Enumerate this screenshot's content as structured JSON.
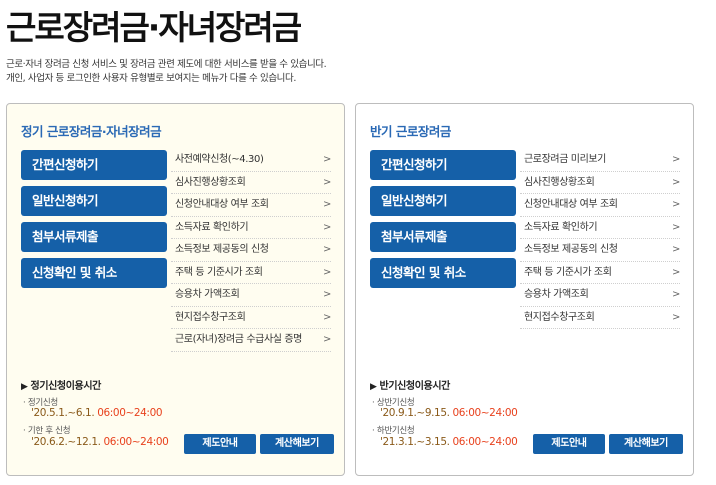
{
  "header": {
    "title": "근로장려금·자녀장려금",
    "desc1": "근로·자녀 장려금 신청 서비스 및 장려금 관련 제도에 대한 서비스를 받을 수 있습니다.",
    "desc2": "개인, 사업자 등 로그인한 사용자 유형별로 보여지는 메뉴가 다를 수 있습니다."
  },
  "left": {
    "title": "정기 근로장려금·자녀장려금",
    "buttons": [
      "간편신청하기",
      "일반신청하기",
      "첨부서류제출",
      "신청확인 및 취소"
    ],
    "links": [
      "사전예약신청(~4.30)",
      "심사진행상황조회",
      "신청안내대상 여부 조회",
      "소득자료 확인하기",
      "소득정보 제공동의 신청",
      "주택 등 기준시가 조회",
      "승용차 가액조회",
      "현지접수창구조회",
      "근로(자녀)장려금 수급사실 증명"
    ],
    "usage_title": "정기신청이용시간",
    "usage": [
      {
        "label": "정기신청",
        "date": "'20.5.1.~6.1.",
        "time": "06:00~24:00"
      },
      {
        "label": "기한 후 신청",
        "date": "'20.6.2.~12.1.",
        "time": "06:00~24:00"
      }
    ],
    "btn1": "제도안내",
    "btn2": "계산해보기"
  },
  "right": {
    "title": "반기 근로장려금",
    "buttons": [
      "간편신청하기",
      "일반신청하기",
      "첨부서류제출",
      "신청확인 및 취소"
    ],
    "links": [
      "근로장려금 미리보기",
      "심사진행상황조회",
      "신청안내대상 여부 조회",
      "소득자료 확인하기",
      "소득정보 제공동의 신청",
      "주택 등 기준시가 조회",
      "승용차 가액조회",
      "현지접수창구조회"
    ],
    "usage_title": "반기신청이용시간",
    "usage": [
      {
        "label": "상반기신청",
        "date": "'20.9.1.~9.15.",
        "time": "06:00~24:00"
      },
      {
        "label": "하반기신청",
        "date": "'21.3.1.~3.15.",
        "time": "06:00~24:00"
      }
    ],
    "btn1": "제도안내",
    "btn2": "계산해보기"
  },
  "icons": {
    "link_arrow": "chevron-right-icon",
    "usage_marker": "triangle-right-icon"
  },
  "colors": {
    "button_blue": "#1560a8",
    "title_blue": "#2a69b5",
    "time_red": "#e8421e",
    "left_panel_bg": "#fffdf0"
  }
}
